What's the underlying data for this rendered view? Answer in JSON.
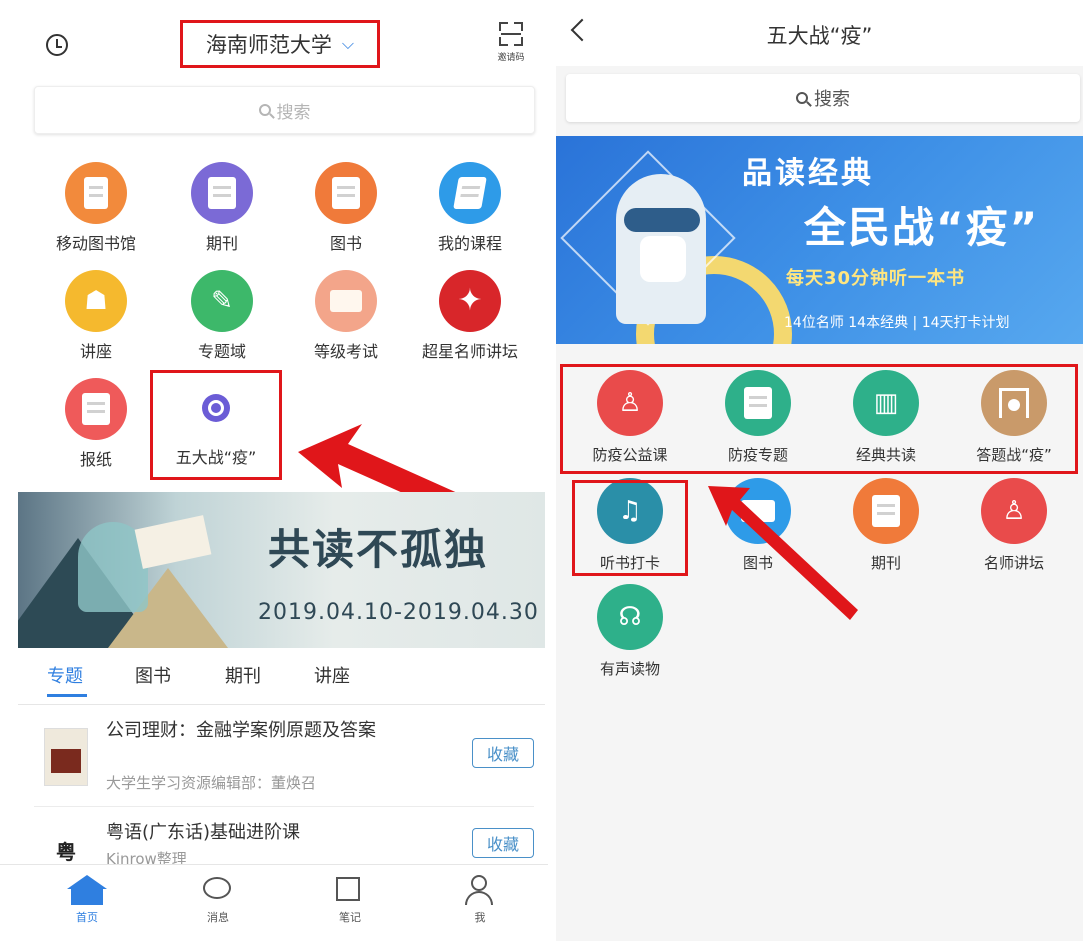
{
  "left": {
    "header": {
      "school": "海南师范大学",
      "scan_label": "邀请码"
    },
    "search": {
      "placeholder": "搜索"
    },
    "grid": [
      {
        "label": "移动图书馆",
        "color": "#f28a3c",
        "icon": "mobile-library-icon"
      },
      {
        "label": "期刊",
        "color": "#7b6ad6",
        "icon": "journal-icon"
      },
      {
        "label": "图书",
        "color": "#f07a3a",
        "icon": "book-icon"
      },
      {
        "label": "我的课程",
        "color": "#2e9be8",
        "icon": "course-icon"
      },
      {
        "label": "讲座",
        "color": "#f5b92e",
        "icon": "lecture-icon"
      },
      {
        "label": "专题域",
        "color": "#3db86a",
        "icon": "feather-icon"
      },
      {
        "label": "等级考试",
        "color": "#f3a58a",
        "icon": "exam-book-icon"
      },
      {
        "label": "超星名师讲坛",
        "color": "#d8262a",
        "icon": "chaoxing-logo-icon"
      },
      {
        "label": "报纸",
        "color": "#ef5a5a",
        "icon": "newspaper-icon"
      },
      {
        "label": "五大战“疫”",
        "color": "#6b5cd6",
        "icon": "target-icon"
      }
    ],
    "banner": {
      "title": "共读不孤独",
      "date": "2019.04.10-2019.04.30"
    },
    "tabs": [
      "专题",
      "图书",
      "期刊",
      "讲座"
    ],
    "list": [
      {
        "title": "公司理财：金融学案例原题及答案",
        "sub": "大学生学习资源编辑部：董焕召",
        "action": "收藏"
      },
      {
        "title": "粤语(广东话)基础进阶课",
        "sub": "Kinrow整理",
        "action": "收藏",
        "cover_char": "粤"
      }
    ],
    "bottom_nav": [
      "首页",
      "消息",
      "笔记",
      "我"
    ]
  },
  "right": {
    "title": "五大战“疫”",
    "search": {
      "placeholder": "搜索"
    },
    "banner": {
      "line1": "品读经典",
      "line2": "全民战“疫”",
      "line3": "每天30分钟听一本书",
      "line4": "14位名师  14本经典  |  14天打卡计划"
    },
    "grid": [
      {
        "label": "防疫公益课",
        "color": "#e94b4b",
        "icon": "podium-icon"
      },
      {
        "label": "防疫专题",
        "color": "#2eb08a",
        "icon": "notepad-icon"
      },
      {
        "label": "经典共读",
        "color": "#2eb08a",
        "icon": "books-icon"
      },
      {
        "label": "答题战“疫”",
        "color": "#c99a6a",
        "icon": "gong-icon"
      },
      {
        "label": "听书打卡",
        "color": "#2a8fa8",
        "icon": "earphones-icon"
      },
      {
        "label": "图书",
        "color": "#2e9be8",
        "icon": "open-book-icon"
      },
      {
        "label": "期刊",
        "color": "#f07a3a",
        "icon": "journal-icon"
      },
      {
        "label": "名师讲坛",
        "color": "#e94b4b",
        "icon": "podium-icon"
      },
      {
        "label": "有声读物",
        "color": "#2eb08a",
        "icon": "headphones-icon"
      }
    ]
  }
}
